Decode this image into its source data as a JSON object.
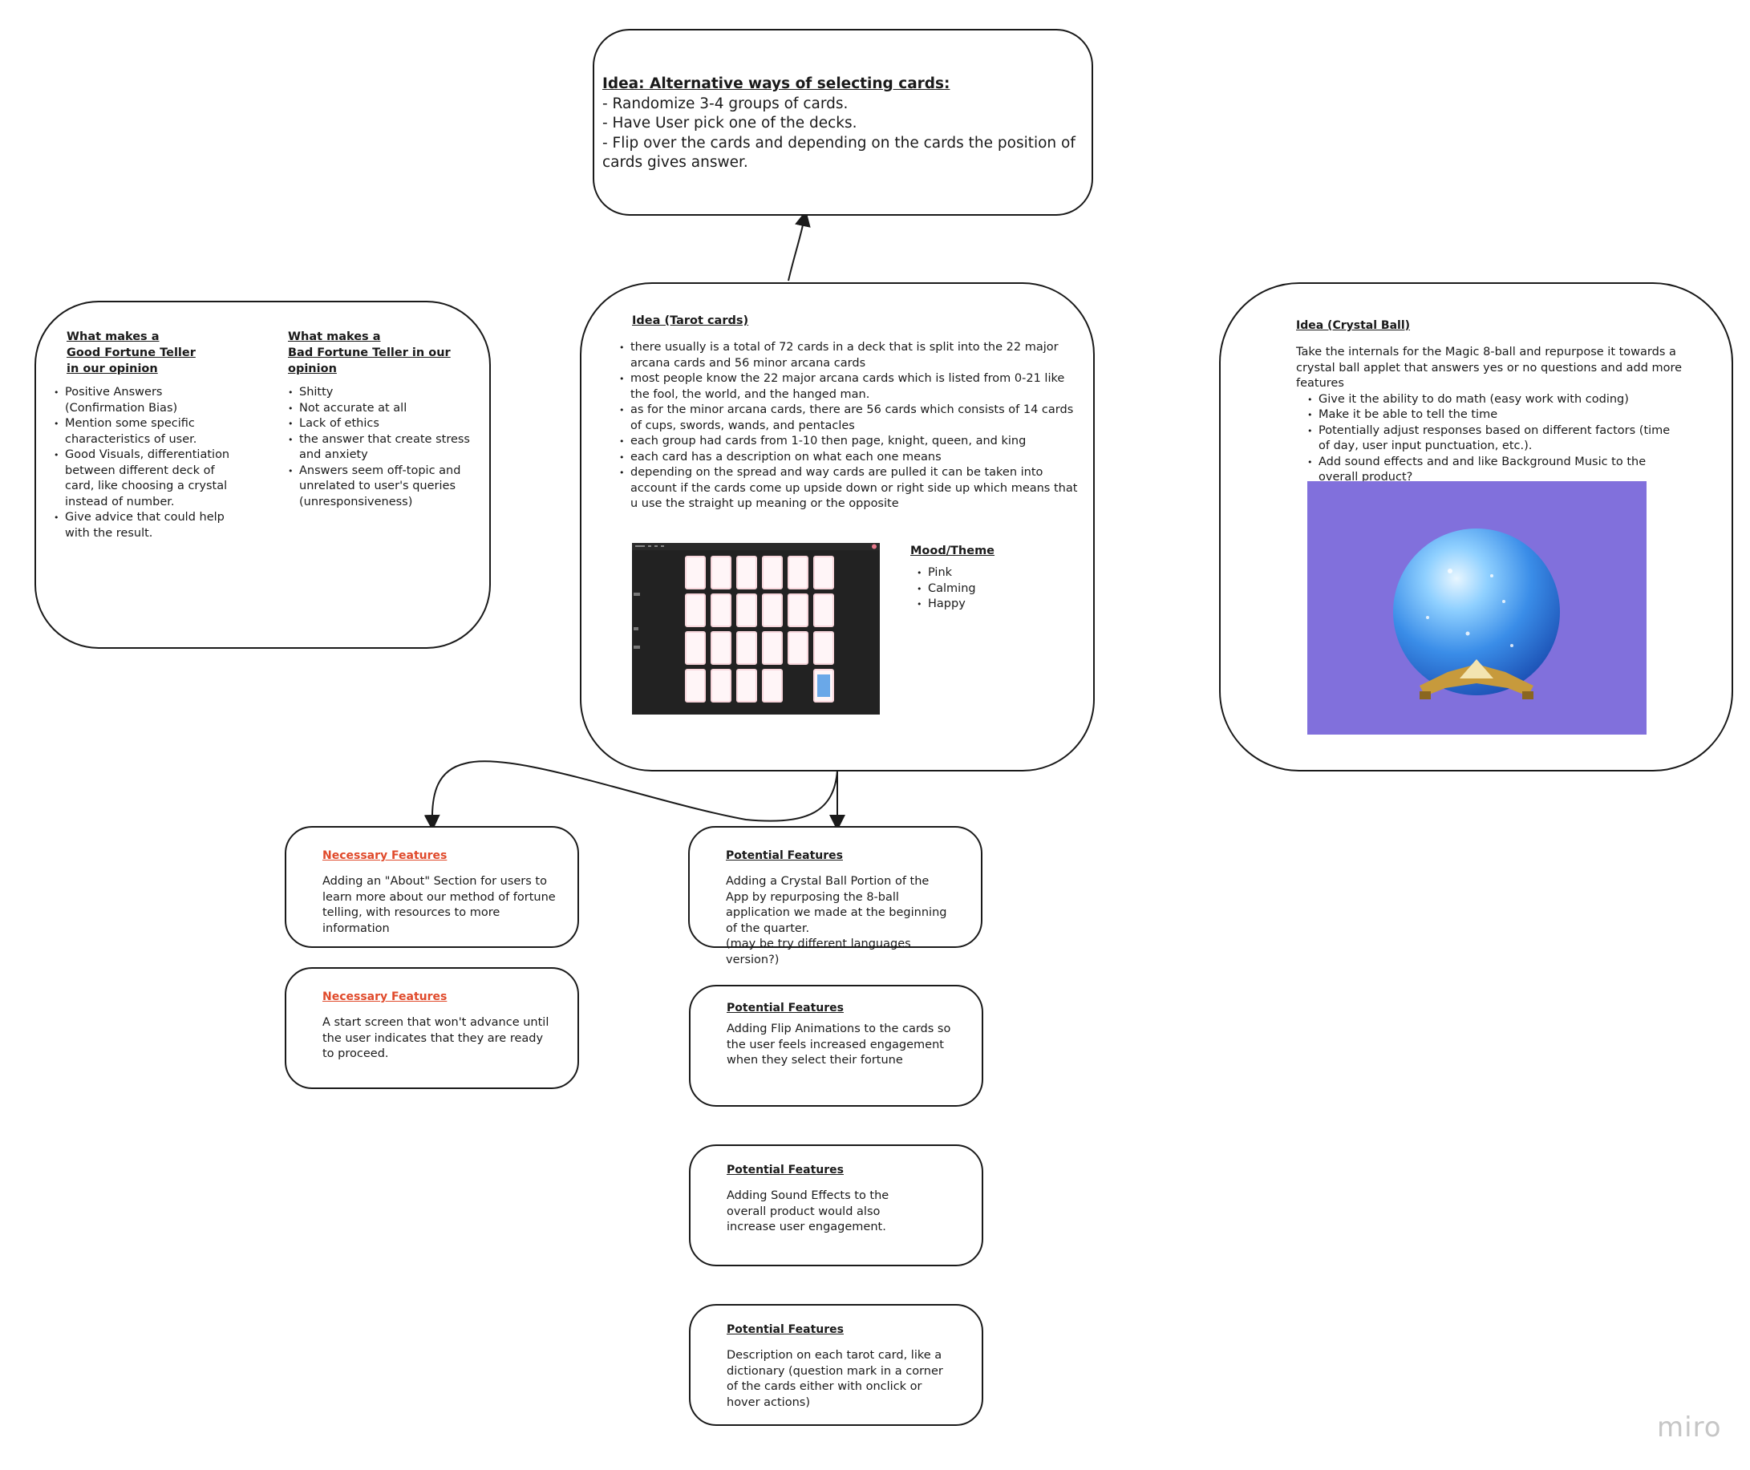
{
  "alt_idea": {
    "title": "Idea: Alternative ways of selecting cards:",
    "lines": [
      "- Randomize 3-4 groups of cards.",
      "- Have User pick one of the decks.",
      "- Flip over the cards and depending on the cards the position of cards gives answer."
    ]
  },
  "fortune_teller": {
    "good_title": [
      "What makes a",
      "Good Fortune Teller",
      "in our opinion"
    ],
    "good_items": [
      "Positive Answers (Confirmation Bias)",
      "Mention some specific characteristics of user.",
      "Good Visuals, differentiation between different deck of card, like choosing a crystal instead of number.",
      "Give advice that could help with the result."
    ],
    "bad_title": [
      "What makes a",
      "Bad Fortune Teller in our",
      "opinion"
    ],
    "bad_items": [
      "Shitty",
      "Not accurate at all",
      "Lack of ethics",
      "the answer that create stress and anxiety",
      "Answers seem off-topic and unrelated to user's queries (unresponsiveness)"
    ]
  },
  "tarot": {
    "title": "Idea (Tarot cards)",
    "items": [
      "there usually is a total of 72 cards in a deck that is split into the 22 major arcana cards and 56 minor arcana cards",
      "most people know the 22 major arcana cards which is listed from 0-21 like the fool, the world, and the hanged man.",
      "as for the minor arcana cards, there are 56 cards which consists of 14 cards of cups, swords, wands, and pentacles",
      "each group had cards from 1-10 then page, knight, queen, and king",
      "each card has a description on what each one means",
      "depending on the spread and way cards are pulled it can be taken into account if the cards come up upside down or right side up which means that u use the straight up meaning or the opposite"
    ],
    "mood_title": "Mood/Theme",
    "mood_items": [
      "Pink",
      "Calming",
      "Happy"
    ]
  },
  "crystal": {
    "title": "Idea (Crystal Ball)",
    "intro": "Take the internals for the Magic 8-ball and repurpose it towards a crystal ball applet that answers yes or no questions and add more features",
    "items": [
      "Give it the ability to do math (easy work with coding)",
      "Make it be able to tell the time",
      "Potentially adjust responses based on different factors (time of day, user input punctuation, etc.).",
      "Add sound effects and and like Background Music to the overall product?"
    ],
    "image_bg": "#8170dc"
  },
  "necessary": [
    {
      "title": "Necessary Features",
      "body": "Adding an \"About\" Section for users to learn more about our method of fortune telling, with resources to more information"
    },
    {
      "title": "Necessary Features",
      "body": "A start screen that won't advance until the user indicates that they are ready to proceed."
    }
  ],
  "potential": [
    {
      "title": "Potential Features",
      "body": "Adding a Crystal Ball  Portion of the App by repurposing the 8-ball application we made at the beginning of the quarter.",
      "extra": "(may be try different languages version?)"
    },
    {
      "title": "Potential Features",
      "body": "Adding Flip Animations to the cards so the user feels increased engagement when they select their fortune"
    },
    {
      "title": "Potential Features",
      "body": "Adding Sound Effects to the overall product would also increase user engagement."
    },
    {
      "title": "Potential Features",
      "body": "Description on each tarot card, like a dictionary (question mark in a corner of the cards either with onclick or hover actions)"
    }
  ],
  "brand": "miro",
  "colors": {
    "accent_red": "#e04a2b",
    "border": "#1a1a1a",
    "card_pink": "#f7d6dc",
    "screen_bg": "#222222"
  }
}
